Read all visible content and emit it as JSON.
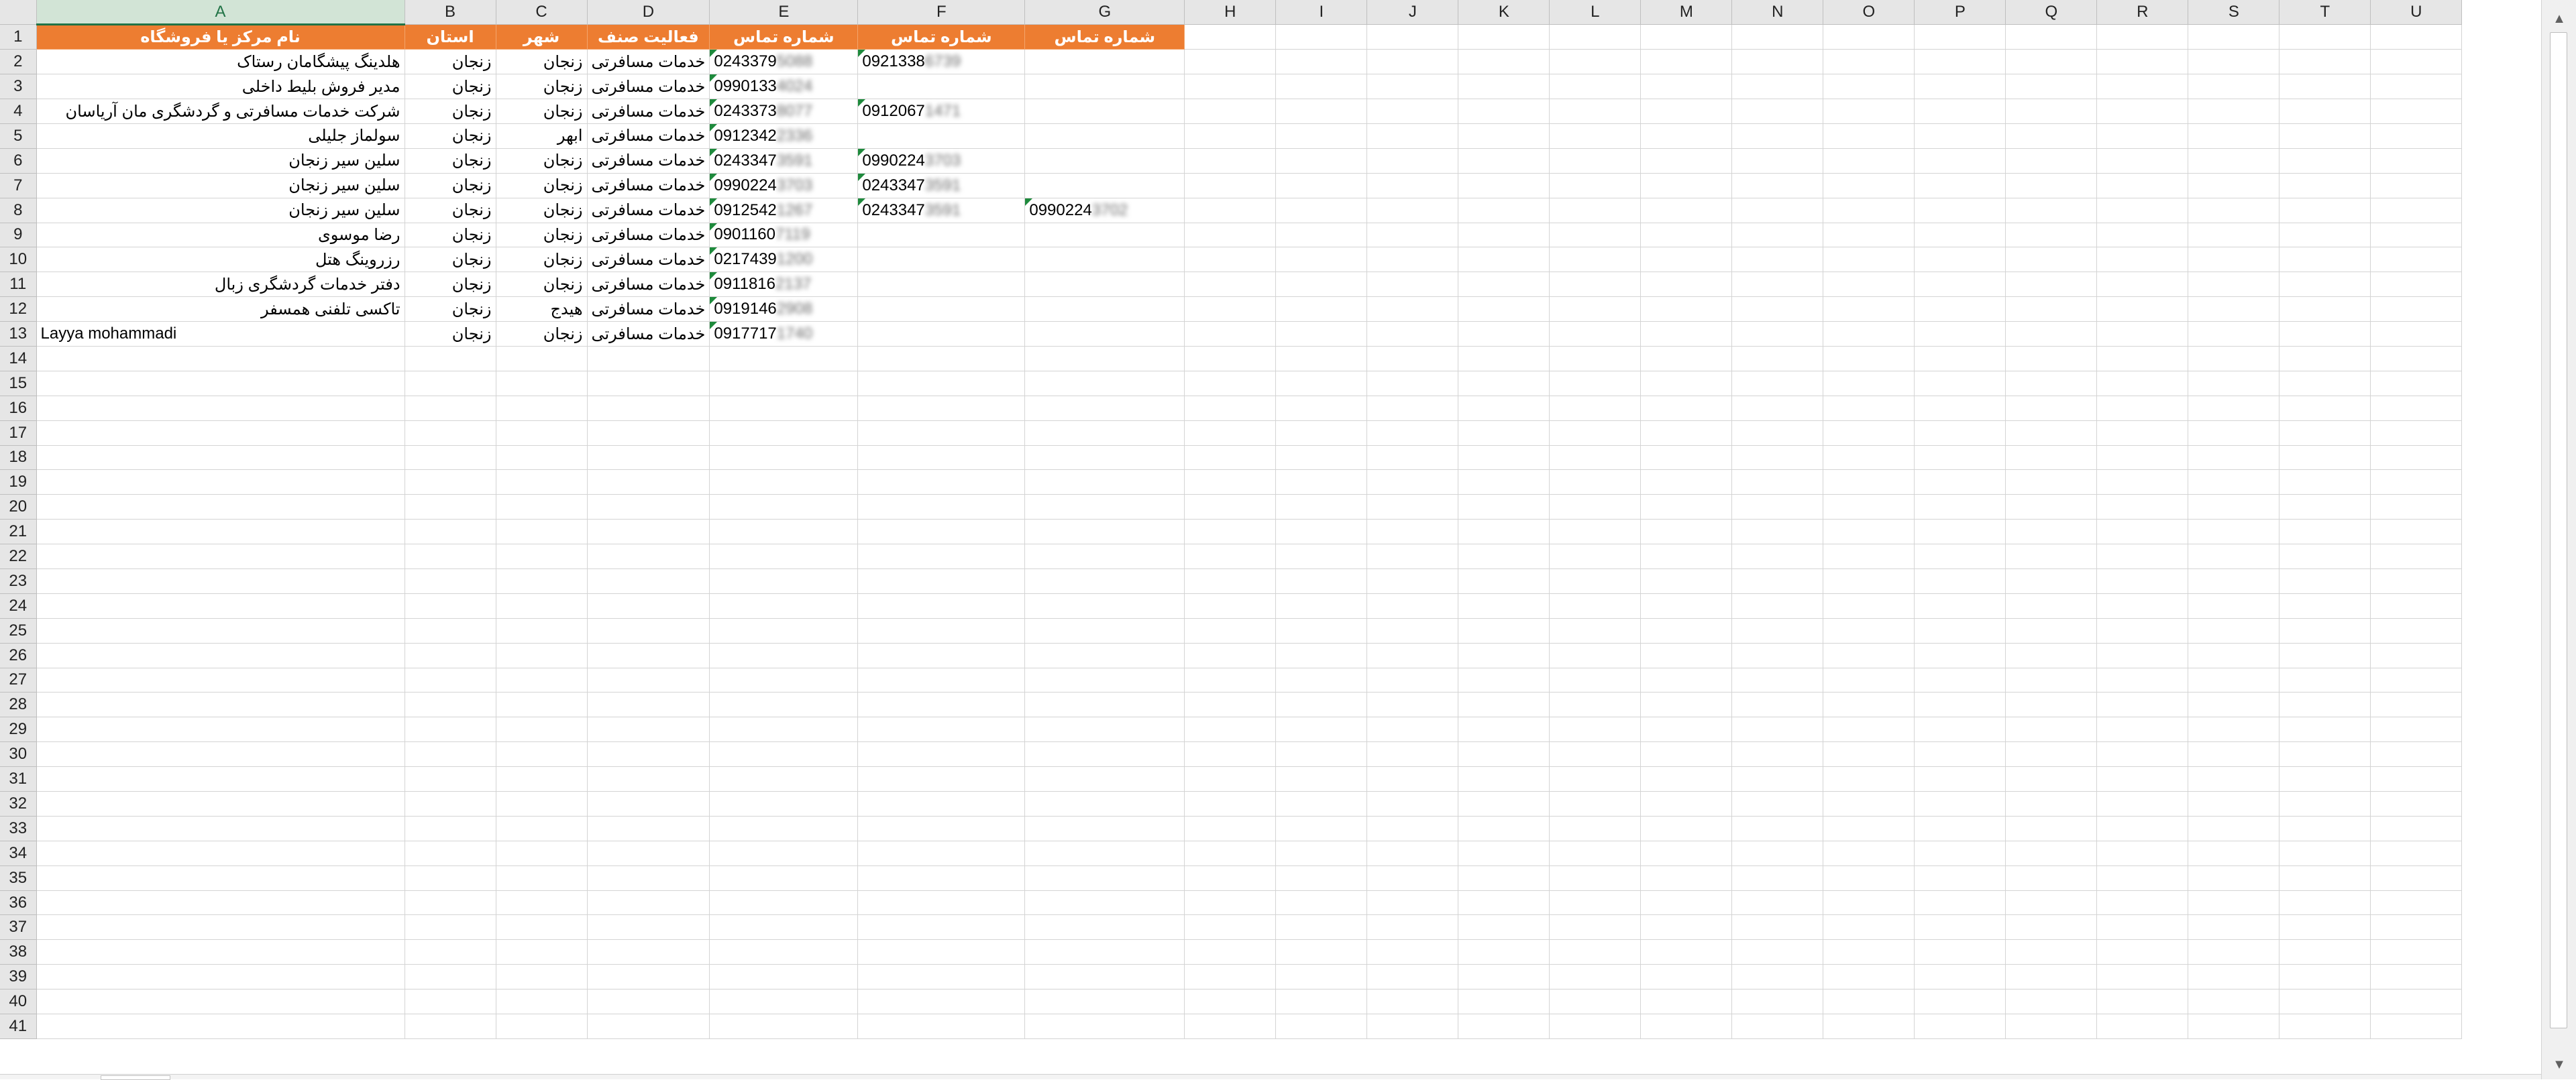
{
  "columns": [
    "A",
    "B",
    "C",
    "D",
    "E",
    "F",
    "G",
    "H",
    "I",
    "J",
    "K",
    "L",
    "M",
    "N",
    "O",
    "P",
    "Q",
    "R",
    "S",
    "T",
    "U"
  ],
  "selected_column": "A",
  "row_count": 41,
  "header_row": [
    "نام مرکز یا فروشگاه",
    "استان",
    "شهر",
    "فعالیت صنف",
    "شماره تماس",
    "شماره تماس",
    "شماره تماس"
  ],
  "rows": [
    {
      "name": "هلدینگ پیشگامان رستاک",
      "province": "زنجان",
      "city": "زنجان",
      "activity": "خدمات مسافرتی",
      "phone1": "0243379",
      "phone1_hidden": "5088",
      "phone2": "0921338",
      "phone2_hidden": "6739",
      "phone3": "",
      "phone3_hidden": ""
    },
    {
      "name": "مدیر فروش بلیط داخلی",
      "province": "زنجان",
      "city": "زنجان",
      "activity": "خدمات مسافرتی",
      "phone1": "0990133",
      "phone1_hidden": "4024",
      "phone2": "",
      "phone2_hidden": "",
      "phone3": "",
      "phone3_hidden": ""
    },
    {
      "name": "شرکت خدمات مسافرتی و گردشگری مان آریاسان",
      "province": "زنجان",
      "city": "زنجان",
      "activity": "خدمات مسافرتی",
      "phone1": "0243373",
      "phone1_hidden": "8077",
      "phone2": "0912067",
      "phone2_hidden": "1471",
      "phone3": "",
      "phone3_hidden": ""
    },
    {
      "name": "سولماز جلیلی",
      "province": "زنجان",
      "city": "ابهر",
      "activity": "خدمات مسافرتی",
      "phone1": "0912342",
      "phone1_hidden": "2336",
      "phone2": "",
      "phone2_hidden": "",
      "phone3": "",
      "phone3_hidden": ""
    },
    {
      "name": "سلین سیر زنجان",
      "province": "زنجان",
      "city": "زنجان",
      "activity": "خدمات مسافرتی",
      "phone1": "0243347",
      "phone1_hidden": "3591",
      "phone2": "0990224",
      "phone2_hidden": "3703",
      "phone3": "",
      "phone3_hidden": ""
    },
    {
      "name": "سلین سیر زنجان",
      "province": "زنجان",
      "city": "زنجان",
      "activity": "خدمات مسافرتی",
      "phone1": "0990224",
      "phone1_hidden": "3703",
      "phone2": "0243347",
      "phone2_hidden": "3591",
      "phone3": "",
      "phone3_hidden": ""
    },
    {
      "name": "سلین سیر زنجان",
      "province": "زنجان",
      "city": "زنجان",
      "activity": "خدمات مسافرتی",
      "phone1": "0912542",
      "phone1_hidden": "1267",
      "phone2": "0243347",
      "phone2_hidden": "3591",
      "phone3": "0990224",
      "phone3_hidden": "3702"
    },
    {
      "name": "رضا موسوی",
      "province": "زنجان",
      "city": "زنجان",
      "activity": "خدمات مسافرتی",
      "phone1": "0901160",
      "phone1_hidden": "7119",
      "phone2": "",
      "phone2_hidden": "",
      "phone3": "",
      "phone3_hidden": ""
    },
    {
      "name": "رزروینگ هتل",
      "province": "زنجان",
      "city": "زنجان",
      "activity": "خدمات مسافرتی",
      "phone1": "0217439",
      "phone1_hidden": "1200",
      "phone2": "",
      "phone2_hidden": "",
      "phone3": "",
      "phone3_hidden": ""
    },
    {
      "name": "دفتر خدمات گردشگری زبال",
      "province": "زنجان",
      "city": "زنجان",
      "activity": "خدمات مسافرتی",
      "phone1": "0911816",
      "phone1_hidden": "2137",
      "phone2": "",
      "phone2_hidden": "",
      "phone3": "",
      "phone3_hidden": ""
    },
    {
      "name": "تاکسی تلفنی همسفر",
      "province": "زنجان",
      "city": "هیدج",
      "activity": "خدمات مسافرتی",
      "phone1": "0919146",
      "phone1_hidden": "2908",
      "phone2": "",
      "phone2_hidden": "",
      "phone3": "",
      "phone3_hidden": ""
    },
    {
      "name": "Layya mohammadi",
      "province": "زنجان",
      "city": "زنجان",
      "activity": "خدمات مسافرتی",
      "phone1": "0917717",
      "phone1_hidden": "1740",
      "phone2": "",
      "phone2_hidden": "",
      "phone3": "",
      "phone3_hidden": ""
    }
  ],
  "colors": {
    "header_fill": "#ed7d31",
    "header_text": "#ffffff",
    "selection": "#217346",
    "flag": "#1e8a3c",
    "gridline": "#d4d4d4"
  },
  "icons": {
    "scroll_up": "chevron-up-icon",
    "scroll_down": "chevron-down-icon",
    "number_as_text_flag": "green-triangle-icon"
  }
}
